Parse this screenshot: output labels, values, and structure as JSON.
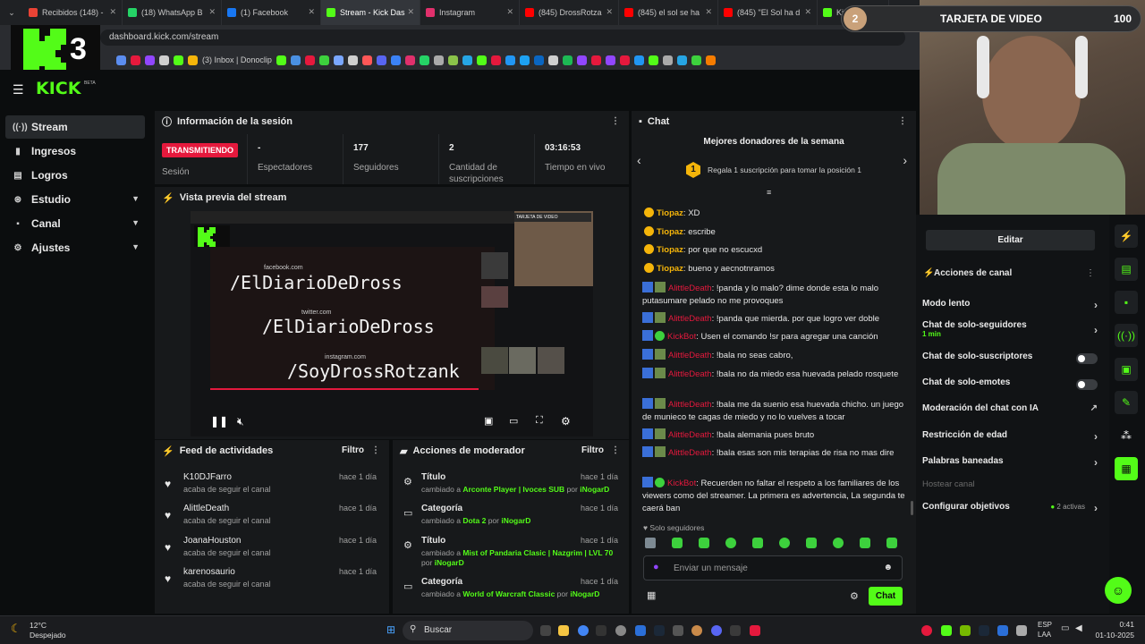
{
  "browser": {
    "tabs": [
      {
        "label": "Recibidos (148) -",
        "color": "#ea4335"
      },
      {
        "label": "(18) WhatsApp B",
        "color": "#25d366"
      },
      {
        "label": "(1) Facebook",
        "color": "#1877f2"
      },
      {
        "label": "Stream - Kick Das",
        "color": "#53fc18"
      },
      {
        "label": "Instagram",
        "color": "#e1306c"
      },
      {
        "label": "(845) DrossRotza",
        "color": "#ff0000"
      },
      {
        "label": "(845) el sol se ha",
        "color": "#ff0000"
      },
      {
        "label": "(845) \"El Sol ha d",
        "color": "#ff0000"
      },
      {
        "label": "Kick - Kic",
        "color": "#53fc18"
      }
    ],
    "url": "dashboard.kick.com/stream",
    "bookmark_label": "(3) Inbox | Donoclip"
  },
  "overlay": {
    "k3_label": "3",
    "gpu_number": "2",
    "gpu_title": "TARJETA DE VIDEO",
    "gpu_value": "100"
  },
  "kick": {
    "logo": "KICK",
    "beta": "BETA"
  },
  "sidebar": {
    "items": [
      {
        "label": "Stream",
        "icon": "stream-icon",
        "active": true
      },
      {
        "label": "Ingresos",
        "icon": "ingresos-icon"
      },
      {
        "label": "Logros",
        "icon": "logros-icon"
      },
      {
        "label": "Estudio",
        "icon": "estudio-icon",
        "chevron": true
      },
      {
        "label": "Canal",
        "icon": "canal-icon",
        "chevron": true
      },
      {
        "label": "Ajustes",
        "icon": "ajustes-icon",
        "chevron": true
      }
    ]
  },
  "session": {
    "title": "Información de la sesión",
    "status": "TRANSMITIENDO",
    "status_label": "Sesión",
    "stats": [
      {
        "value": "-",
        "label": "Espectadores"
      },
      {
        "value": "177",
        "label": "Seguidores"
      },
      {
        "value": "2",
        "label": "Cantidad de suscripciones"
      },
      {
        "value": "03:16:53",
        "label": "Tiempo en vivo"
      }
    ]
  },
  "preview": {
    "title": "Vista previa del stream",
    "lines": [
      "/ElDiarioDeDross",
      "/ElDiarioDeDross",
      "/SoyDrossRotzank"
    ],
    "small": [
      "facebook.com",
      "twitter.com",
      "instagram.com"
    ]
  },
  "feed": {
    "title": "Feed de actividades",
    "filter": "Filtro",
    "items": [
      {
        "name": "K10DJFarro",
        "sub": "acaba de seguir el canal",
        "time": "hace 1 día"
      },
      {
        "name": "AlittleDeath",
        "sub": "acaba de seguir el canal",
        "time": "hace 1 día"
      },
      {
        "name": "JoanaHouston",
        "sub": "acaba de seguir el canal",
        "time": "hace 1 día"
      },
      {
        "name": "karenosaurio",
        "sub": "acaba de seguir el canal",
        "time": "hace 1 día"
      }
    ]
  },
  "modactions": {
    "title": "Acciones de moderador",
    "filter": "Filtro",
    "items": [
      {
        "title": "Título",
        "pre": "cambiado a",
        "value": "Arconte Player | Ivoces SUB",
        "by": "por",
        "user": "iNogarD",
        "time": "hace 1 día"
      },
      {
        "title": "Categoría",
        "pre": "cambiado a",
        "value": "Dota 2",
        "by": "por",
        "user": "iNogarD",
        "time": "hace 1 día"
      },
      {
        "title": "Título",
        "pre": "cambiado a",
        "value": "Mist of Pandaria Clasic | Nazgrim | LVL 70",
        "by": "por",
        "user": "iNogarD",
        "time": "hace 1 día"
      },
      {
        "title": "Categoría",
        "pre": "cambiado a",
        "value": "World of Warcraft Classic",
        "by": "por",
        "user": "iNogarD",
        "time": "hace 1 día"
      }
    ]
  },
  "chat": {
    "title": "Chat",
    "donors_title": "Mejores donadores de la semana",
    "donors_rank": "1",
    "donors_text": "Regala 1 suscripción para tomar la posición 1",
    "messages": [
      {
        "user": "Tiopaz",
        "text": ": XD"
      },
      {
        "user": "Tiopaz",
        "text": ": escribe"
      },
      {
        "user": "Tiopaz",
        "text": ": por que no escucxd"
      },
      {
        "user": "Tiopaz",
        "text": ": bueno y aecnotnramos"
      },
      {
        "user": "AlittleDeath",
        "text": ": !panda y lo malo? dime donde esta lo malo putasumare pelado no me provoques"
      },
      {
        "user": "AlittleDeath",
        "text": ": !panda que mierda. por que logro ver doble"
      },
      {
        "user": "KickBot",
        "text": ": Usen el comando !sr para agregar una canción"
      },
      {
        "user": "AlittleDeath",
        "text": ": !bala no seas cabro,"
      },
      {
        "user": "AlittleDeath",
        "text": ": !bala no da miedo esa huevada pelado rosquete"
      },
      {
        "user": "AlittleDeath",
        "text": ": !bala me da suenio esa huevada chicho. un juego de munieco te cagas de miedo y no lo vuelves a tocar"
      },
      {
        "user": "AlittleDeath",
        "text": ": !bala alemania pues bruto"
      },
      {
        "user": "AlittleDeath",
        "text": ": !bala esas son mis terapias de risa no mas dire"
      },
      {
        "user": "KickBot",
        "text": ": Recuerden no faltar el respeto a los familiares de los viewers como del streamer. La primera es advertencia, La segunda te caerá ban"
      }
    ],
    "followers_only": "Solo seguidores",
    "input_placeholder": "Enviar un mensaje",
    "send": "Chat"
  },
  "right": {
    "edit": "Editar",
    "actions_title": "Acciones de canal",
    "rows": [
      {
        "label": "Modo lento",
        "type": "arrow"
      },
      {
        "label": "Chat de solo-seguidores",
        "sub": "1 min",
        "type": "arrow"
      },
      {
        "label": "Chat de solo-suscriptores",
        "type": "toggle"
      },
      {
        "label": "Chat de solo-emotes",
        "type": "toggle"
      },
      {
        "label": "Moderación del chat con IA",
        "type": "link"
      },
      {
        "label": "Restricción de edad",
        "type": "arrow"
      },
      {
        "label": "Palabras baneadas",
        "type": "arrow"
      },
      {
        "label": "Hostear canal",
        "type": "disabled"
      },
      {
        "label": "Configurar objetivos",
        "sub": "2 activas",
        "type": "arrow"
      }
    ]
  },
  "taskbar": {
    "temp": "12°C",
    "weather": "Despejado",
    "search": "Buscar",
    "lang1": "ESP",
    "lang2": "LAA",
    "time": "0:41",
    "date": "01-10-2025"
  },
  "colors": {
    "accent": "#53fc18",
    "live": "#e5193d"
  }
}
